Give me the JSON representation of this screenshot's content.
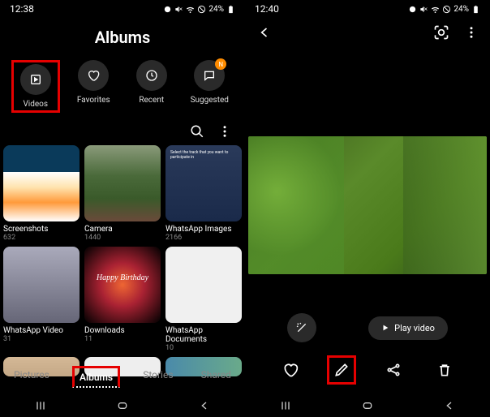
{
  "left": {
    "time": "12:38",
    "battery": "24%",
    "title": "Albums",
    "quick": [
      {
        "label": "Videos",
        "icon": "play"
      },
      {
        "label": "Favorites",
        "icon": "heart"
      },
      {
        "label": "Recent",
        "icon": "clock"
      },
      {
        "label": "Suggested",
        "icon": "chat",
        "badge": "N"
      }
    ],
    "albums": [
      {
        "name": "Screenshots",
        "count": "632"
      },
      {
        "name": "Camera",
        "count": "1440"
      },
      {
        "name": "WhatsApp Images",
        "count": "2166"
      },
      {
        "name": "WhatsApp Video",
        "count": "31"
      },
      {
        "name": "Downloads",
        "count": "11"
      },
      {
        "name": "WhatsApp Documents",
        "count": "10"
      }
    ],
    "tabs": [
      "Pictures",
      "Albums",
      "Stories",
      "Shared"
    ],
    "active_tab": "Albums"
  },
  "right": {
    "time": "12:40",
    "battery": "24%",
    "play_label": "Play video"
  }
}
